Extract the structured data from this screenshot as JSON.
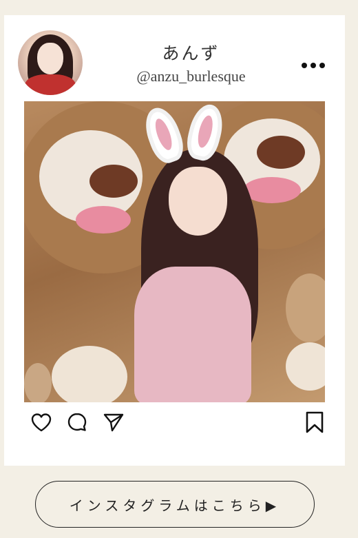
{
  "profile": {
    "display_name": "あんず",
    "username": "@anzu_burlesque"
  },
  "post": {
    "actions": [
      "heart-icon",
      "comment-icon",
      "share-icon",
      "bookmark-icon"
    ]
  },
  "cta": {
    "label": "インスタグラムはこちら▶"
  },
  "colors": {
    "page_background": "#f3efe5",
    "card_background": "#ffffff",
    "text": "#222222"
  }
}
